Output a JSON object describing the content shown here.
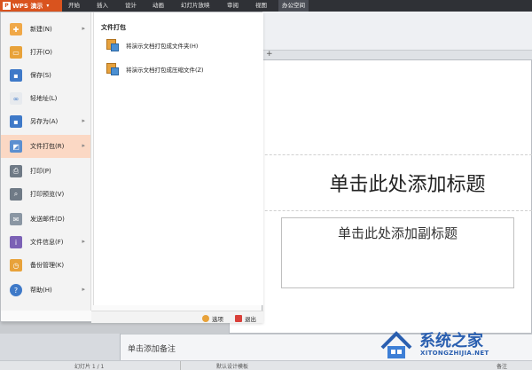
{
  "app": {
    "title": "WPS 演示",
    "logo_text": "P"
  },
  "ribbon_tabs": [
    {
      "label": "开始"
    },
    {
      "label": "插入"
    },
    {
      "label": "设计"
    },
    {
      "label": "动画"
    },
    {
      "label": "幻灯片放映"
    },
    {
      "label": "审阅"
    },
    {
      "label": "视图"
    },
    {
      "label": "办公空间"
    }
  ],
  "file_menu": {
    "items": [
      {
        "label": "新建(N)",
        "icon": "new-icon"
      },
      {
        "label": "打开(O)",
        "icon": "open-folder-icon"
      },
      {
        "label": "保存(S)",
        "icon": "save-icon"
      },
      {
        "label": "轻地址(L)",
        "icon": "link-icon"
      },
      {
        "label": "另存为(A)",
        "icon": "save-as-icon"
      },
      {
        "label": "文件打包(R)",
        "icon": "package-icon"
      },
      {
        "label": "打印(P)",
        "icon": "print-icon"
      },
      {
        "label": "打印预览(V)",
        "icon": "print-preview-icon"
      },
      {
        "label": "发送邮件(D)",
        "icon": "mail-icon"
      },
      {
        "label": "文件信息(F)",
        "icon": "file-info-icon"
      },
      {
        "label": "备份管理(K)",
        "icon": "backup-icon"
      },
      {
        "label": "帮助(H)",
        "icon": "help-icon"
      }
    ],
    "submenu": {
      "heading": "文件打包",
      "items": [
        {
          "label": "将演示文档打包成文件夹(H)",
          "icon": "package-folder-icon"
        },
        {
          "label": "将演示文档打包成压缩文件(Z)",
          "icon": "package-zip-icon"
        }
      ]
    },
    "footer": {
      "options_label": "选项",
      "exit_label": "退出"
    }
  },
  "slide": {
    "title_placeholder": "单击此处添加标题",
    "subtitle_placeholder": "单击此处添加副标题"
  },
  "notes_placeholder": "单击添加备注",
  "status": {
    "slide_counter": "幻灯片 1 / 1",
    "design_template": "默认设计模板",
    "remark_label": "备注"
  },
  "watermark": {
    "title": "系统之家",
    "url": "XITONGZHIJIA.NET"
  },
  "colors": {
    "accent": "#d9531e",
    "topbar": "#2f3136",
    "menu_selected": "#fbd8c4",
    "watermark": "#2a5fb0"
  }
}
